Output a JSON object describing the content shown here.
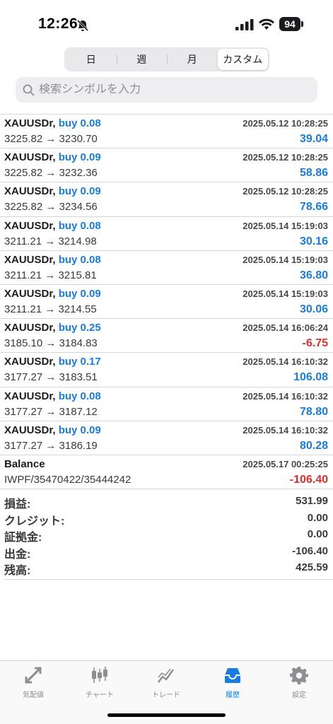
{
  "status_bar": {
    "time": "12:26",
    "battery": "94"
  },
  "period_tabs": [
    {
      "label": "日",
      "active": false
    },
    {
      "label": "週",
      "active": false
    },
    {
      "label": "月",
      "active": false
    },
    {
      "label": "カスタム",
      "active": true
    }
  ],
  "search": {
    "placeholder": "検索シンボルを入力"
  },
  "deals": [
    {
      "symbol": "XAUUSDr,",
      "side": "buy 0.08",
      "datetime": "2025.05.12 10:28:25",
      "prices": "3225.82 → 3230.70",
      "profit": "39.04",
      "sign": "pos"
    },
    {
      "symbol": "XAUUSDr,",
      "side": "buy 0.09",
      "datetime": "2025.05.12 10:28:25",
      "prices": "3225.82 → 3232.36",
      "profit": "58.86",
      "sign": "pos"
    },
    {
      "symbol": "XAUUSDr,",
      "side": "buy 0.09",
      "datetime": "2025.05.12 10:28:25",
      "prices": "3225.82 → 3234.56",
      "profit": "78.66",
      "sign": "pos"
    },
    {
      "symbol": "XAUUSDr,",
      "side": "buy 0.08",
      "datetime": "2025.05.14 15:19:03",
      "prices": "3211.21 → 3214.98",
      "profit": "30.16",
      "sign": "pos"
    },
    {
      "symbol": "XAUUSDr,",
      "side": "buy 0.08",
      "datetime": "2025.05.14 15:19:03",
      "prices": "3211.21 → 3215.81",
      "profit": "36.80",
      "sign": "pos"
    },
    {
      "symbol": "XAUUSDr,",
      "side": "buy 0.09",
      "datetime": "2025.05.14 15:19:03",
      "prices": "3211.21 → 3214.55",
      "profit": "30.06",
      "sign": "pos"
    },
    {
      "symbol": "XAUUSDr,",
      "side": "buy 0.25",
      "datetime": "2025.05.14 16:06:24",
      "prices": "3185.10 → 3184.83",
      "profit": "-6.75",
      "sign": "neg"
    },
    {
      "symbol": "XAUUSDr,",
      "side": "buy 0.17",
      "datetime": "2025.05.14 16:10:32",
      "prices": "3177.27 → 3183.51",
      "profit": "106.08",
      "sign": "pos"
    },
    {
      "symbol": "XAUUSDr,",
      "side": "buy 0.08",
      "datetime": "2025.05.14 16:10:32",
      "prices": "3177.27 → 3187.12",
      "profit": "78.80",
      "sign": "pos"
    },
    {
      "symbol": "XAUUSDr,",
      "side": "buy 0.09",
      "datetime": "2025.05.14 16:10:32",
      "prices": "3177.27 → 3186.19",
      "profit": "80.28",
      "sign": "pos"
    },
    {
      "symbol": "Balance",
      "side": "",
      "datetime": "2025.05.17 00:25:25",
      "prices": "IWPF/35470422/35444242",
      "profit": "-106.40",
      "sign": "neg"
    }
  ],
  "summary": [
    {
      "label": "損益:",
      "value": "531.99"
    },
    {
      "label": "クレジット:",
      "value": "0.00"
    },
    {
      "label": "証拠金:",
      "value": "0.00"
    },
    {
      "label": "出金:",
      "value": "-106.40"
    },
    {
      "label": "残高:",
      "value": "425.59"
    }
  ],
  "tabbar": [
    {
      "label": "気配値",
      "icon": "quotes-icon",
      "active": false
    },
    {
      "label": "チャート",
      "icon": "chart-icon",
      "active": false
    },
    {
      "label": "トレード",
      "icon": "trade-icon",
      "active": false
    },
    {
      "label": "履歴",
      "icon": "history-icon",
      "active": true
    },
    {
      "label": "設定",
      "icon": "settings-icon",
      "active": false
    }
  ],
  "colors": {
    "accent": "#1a7ce0",
    "negative": "#e0302b"
  }
}
